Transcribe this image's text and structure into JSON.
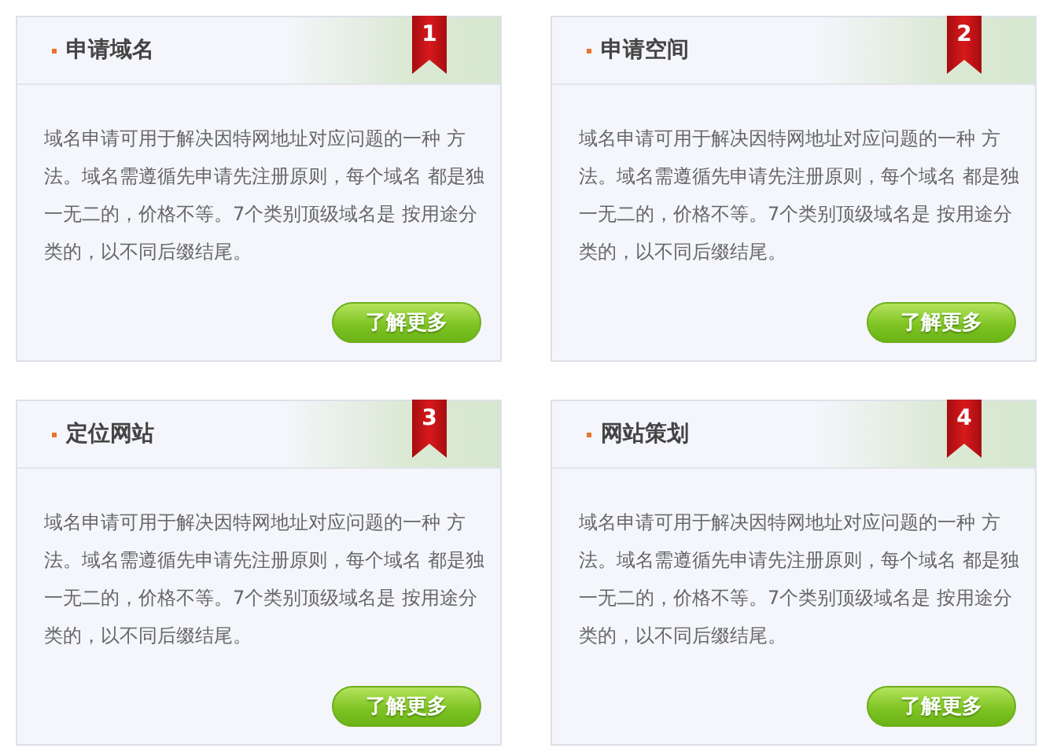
{
  "cards": [
    {
      "number": "1",
      "title": "申请域名",
      "description": "域名申请可用于解决因特网地址对应问题的一种 方法。域名需遵循先申请先注册原则，每个域名 都是独一无二的，价格不等。7个类别顶级域名是 按用途分类的，以不同后缀结尾。",
      "button": "了解更多"
    },
    {
      "number": "2",
      "title": "申请空间",
      "description": "域名申请可用于解决因特网地址对应问题的一种 方法。域名需遵循先申请先注册原则，每个域名 都是独一无二的，价格不等。7个类别顶级域名是 按用途分类的，以不同后缀结尾。",
      "button": "了解更多"
    },
    {
      "number": "3",
      "title": "定位网站",
      "description": "域名申请可用于解决因特网地址对应问题的一种 方法。域名需遵循先申请先注册原则，每个域名 都是独一无二的，价格不等。7个类别顶级域名是 按用途分类的，以不同后缀结尾。",
      "button": "了解更多"
    },
    {
      "number": "4",
      "title": "网站策划",
      "description": "域名申请可用于解决因特网地址对应问题的一种 方法。域名需遵循先申请先注册原则，每个域名 都是独一无二的，价格不等。7个类别顶级域名是 按用途分类的，以不同后缀结尾。",
      "button": "了解更多"
    }
  ]
}
